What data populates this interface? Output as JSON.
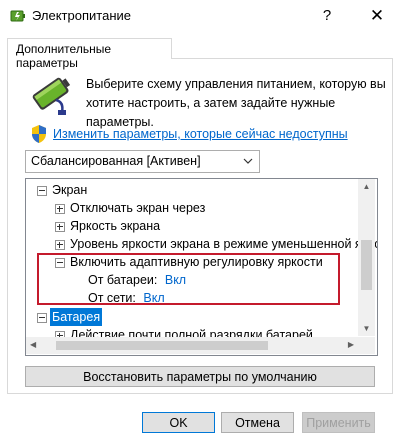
{
  "window": {
    "title": "Электропитание",
    "help_glyph": "?",
    "close_glyph": "✕"
  },
  "tab": {
    "label": "Дополнительные параметры"
  },
  "description": "Выберите схему управления питанием, которую вы хотите настроить, а затем задайте нужные параметры.",
  "change_link": "Изменить параметры, которые сейчас недоступны",
  "plan_select": {
    "value": "Сбалансированная [Активен]"
  },
  "tree": {
    "items": [
      {
        "label": "Экран"
      },
      {
        "label": "Отключать экран через"
      },
      {
        "label": "Яркость экрана"
      },
      {
        "label": "Уровень яркости экрана в режиме уменьшенной яркости"
      },
      {
        "label": "Включить адаптивную регулировку яркости"
      },
      {
        "label": "От батареи:",
        "value": "Вкл"
      },
      {
        "label": "От сети:",
        "value": "Вкл"
      },
      {
        "label": "Батарея"
      },
      {
        "label": "Действие почти полной разрядки батарей"
      }
    ]
  },
  "buttons": {
    "restore": "Восстановить параметры по умолчанию",
    "ok": "OK",
    "cancel": "Отмена",
    "apply": "Применить"
  }
}
